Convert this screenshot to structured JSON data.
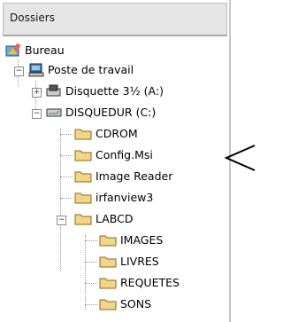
{
  "panel": {
    "title": "Dossiers"
  },
  "tree": {
    "bureau": "Bureau",
    "poste": "Poste de travail",
    "disquette": "Disquette 3½ (A:)",
    "disquedur": "DISQUEDUR (C:)",
    "cdrom": "CDROM",
    "configmsi": "Config.Msi",
    "imagereader": "Image Reader",
    "irfanview": "irfanview3",
    "labcd": "LABCD",
    "images": "IMAGES",
    "livres": "LIVRES",
    "requetes": "REQUETES",
    "sons": "SONS"
  },
  "expanders": {
    "expanded": "−",
    "collapsed": "+"
  },
  "colors": {
    "folder": "#f0d58a",
    "folder_border": "#8a6a1a",
    "arrow": "#000000"
  }
}
